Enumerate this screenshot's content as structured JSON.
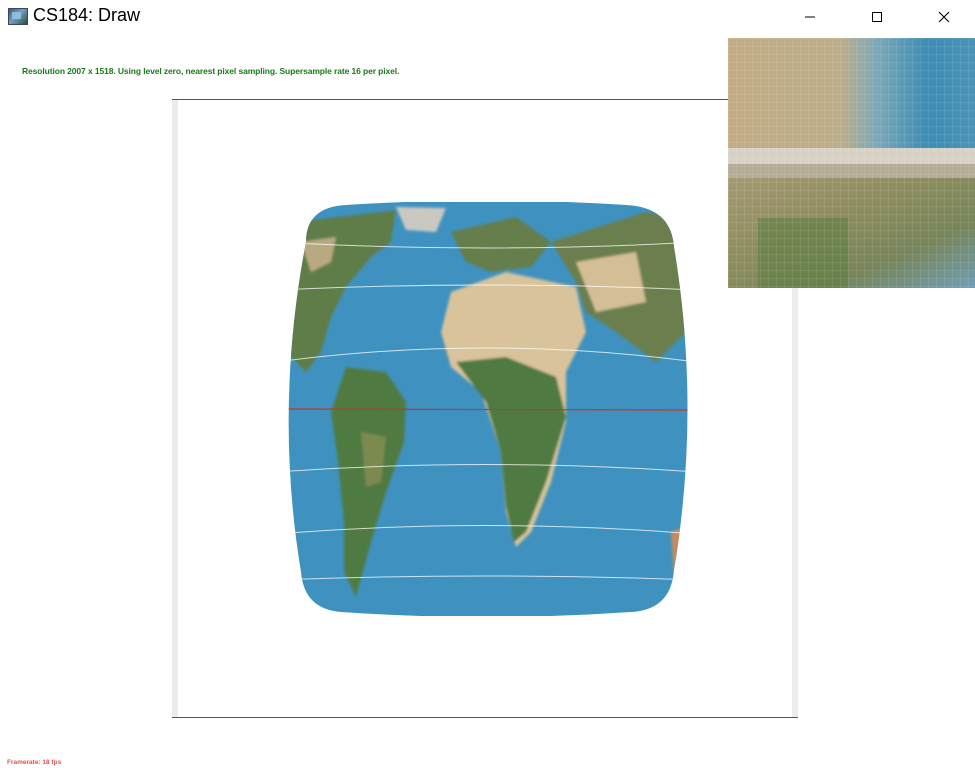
{
  "window": {
    "title": "CS184: Draw"
  },
  "controls": {
    "minimize": "minimize",
    "maximize": "maximize",
    "close": "close"
  },
  "status": {
    "text": "Resolution 2007 x 1518. Using level zero, nearest pixel sampling. Supersample rate 16 per pixel."
  },
  "footer": {
    "framerate": "Framerate: 18 fps"
  },
  "colors": {
    "status": "#1a7a1a",
    "framerate": "#e05050",
    "ocean": "#3f92bf",
    "land_green": "#4f7a43",
    "land_desert": "#d8c39b",
    "equator": "#c0392b"
  }
}
